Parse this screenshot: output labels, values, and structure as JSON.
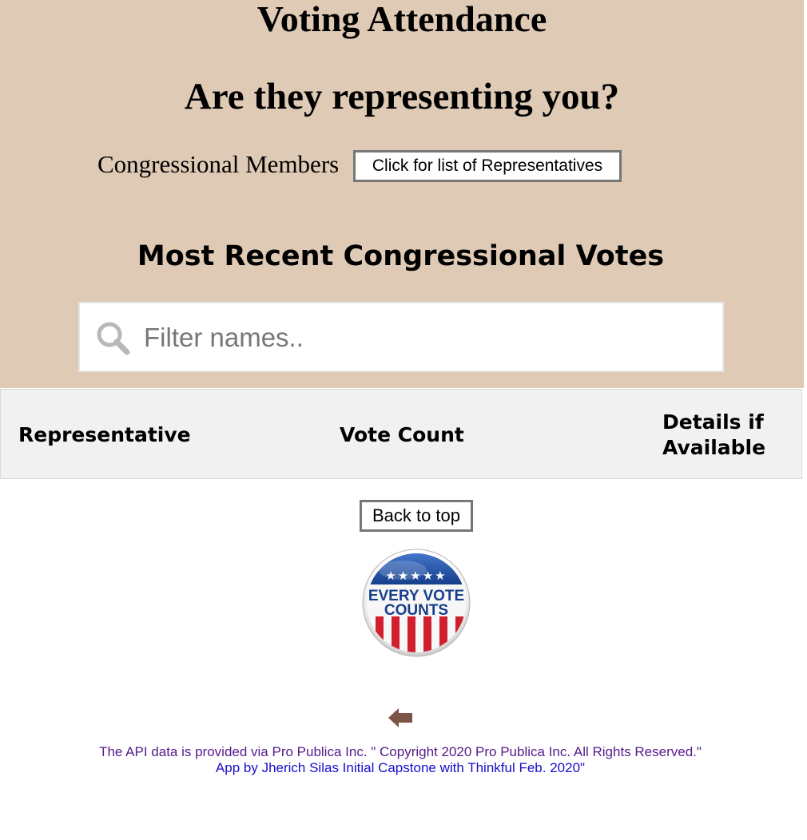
{
  "header": {
    "title": "Voting Attendance",
    "subtitle": "Are they representing you?",
    "members_label": "Congressional Members",
    "members_button": "Click for list of Representatives"
  },
  "votes": {
    "heading": "Most Recent Congressional Votes",
    "filter_placeholder": "Filter names..",
    "filter_value": ""
  },
  "table": {
    "columns": [
      "Representative",
      "Vote Count",
      "Details if Available"
    ],
    "rows": []
  },
  "back_to_top_label": "Back to top",
  "badge": {
    "line1": "EVERY VOTE",
    "line2": "COUNTS",
    "stars": "★★★★★"
  },
  "icons": {
    "search": "search-icon",
    "back": "back-arrow-icon"
  },
  "footer": {
    "api_credit": "The API data is provided via Pro Publica Inc. \" Copyright 2020 Pro Publica Inc. All Rights Reserved.\"",
    "app_credit": "App by Jherich Silas Initial Capstone with Thinkful Feb. 2020\""
  },
  "colors": {
    "header_bg": "#decab5",
    "table_head_bg": "#f1f1f1",
    "visited_link": "#551a8b",
    "link": "#1a0dcc",
    "arrow": "#7a5548"
  }
}
